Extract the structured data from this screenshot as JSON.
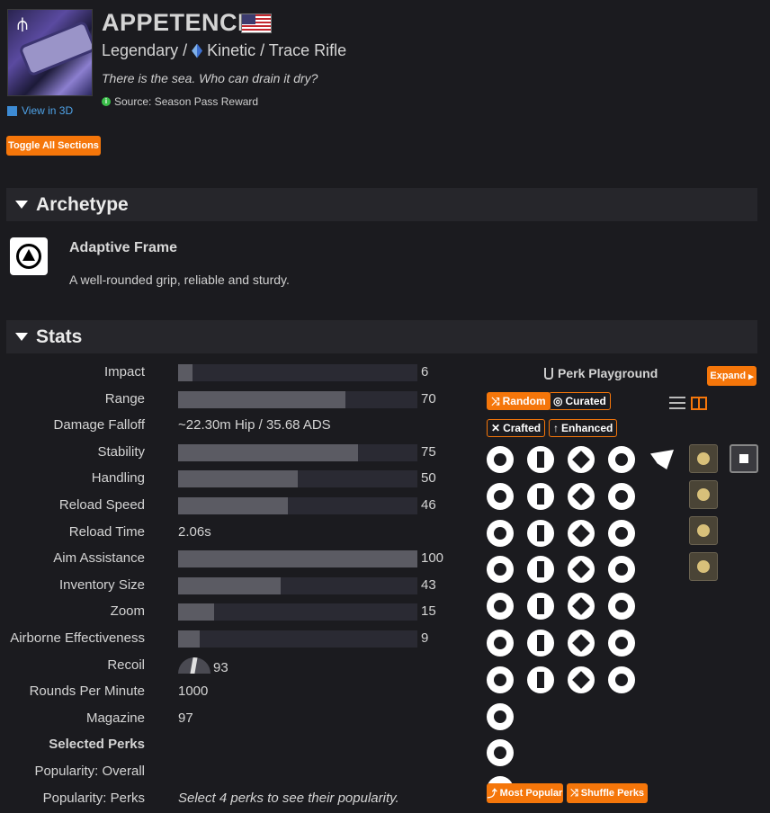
{
  "weapon": {
    "name": "APPETENCE",
    "rarity": "Legendary /",
    "subtitle_rest": "Kinetic / Trace Rifle",
    "flavor": "There is the sea. Who can drain it dry?",
    "source": "Source: Season Pass Reward",
    "view_3d": "View in 3D"
  },
  "toggle_all": "Toggle All Sections",
  "archetype": {
    "section_title": "Archetype",
    "name": "Adaptive Frame",
    "description": "A well-rounded grip, reliable and sturdy."
  },
  "stats_section_title": "Stats",
  "stats": [
    {
      "label": "Impact",
      "value": "6",
      "fraction": 0.06
    },
    {
      "label": "Range",
      "value": "70",
      "fraction": 0.7
    },
    {
      "label": "Damage Falloff",
      "text": "~22.30m Hip / 35.68 ADS"
    },
    {
      "label": "Stability",
      "value": "75",
      "fraction": 0.75
    },
    {
      "label": "Handling",
      "value": "50",
      "fraction": 0.5
    },
    {
      "label": "Reload Speed",
      "value": "46",
      "fraction": 0.46
    },
    {
      "label": "Reload Time",
      "text": "2.06s"
    },
    {
      "label": "Aim Assistance",
      "value": "100",
      "fraction": 1.0
    },
    {
      "label": "Inventory Size",
      "value": "43",
      "fraction": 0.43
    },
    {
      "label": "Zoom",
      "value": "15",
      "fraction": 0.15
    },
    {
      "label": "Airborne Effectiveness",
      "value": "9",
      "fraction": 0.09
    },
    {
      "label": "Recoil",
      "recoil": "93"
    },
    {
      "label": "Rounds Per Minute",
      "text": "1000"
    },
    {
      "label": "Magazine",
      "text": "97"
    },
    {
      "label": "Selected Perks",
      "heading": true
    },
    {
      "label": "Popularity: Overall",
      "text": ""
    },
    {
      "label": "Popularity: Perks",
      "text": "Select 4 perks to see their popularity.",
      "italic": true
    }
  ],
  "playground": {
    "title": "Perk Playground",
    "expand": "Expand",
    "random": "Random",
    "curated": "Curated",
    "crafted": "Crafted",
    "enhanced": "Enhanced",
    "most_popular": "Most Popular",
    "shuffle_perks": "Shuffle Perks"
  },
  "perk_columns": [
    {
      "type": "barrel",
      "count": 10
    },
    {
      "type": "magazine",
      "count": 7
    },
    {
      "type": "trait1",
      "count": 7
    },
    {
      "type": "trait2",
      "count": 7
    },
    {
      "type": "origin",
      "count": 1
    },
    {
      "type": "masterwork",
      "count": 4
    },
    {
      "type": "mod",
      "count": 1
    }
  ],
  "colors": {
    "accent": "#f5760a",
    "background": "#1b1b1f",
    "section": "#26262b",
    "bar_fill": "#5b5b63",
    "bar_track": "#2a2a33"
  }
}
